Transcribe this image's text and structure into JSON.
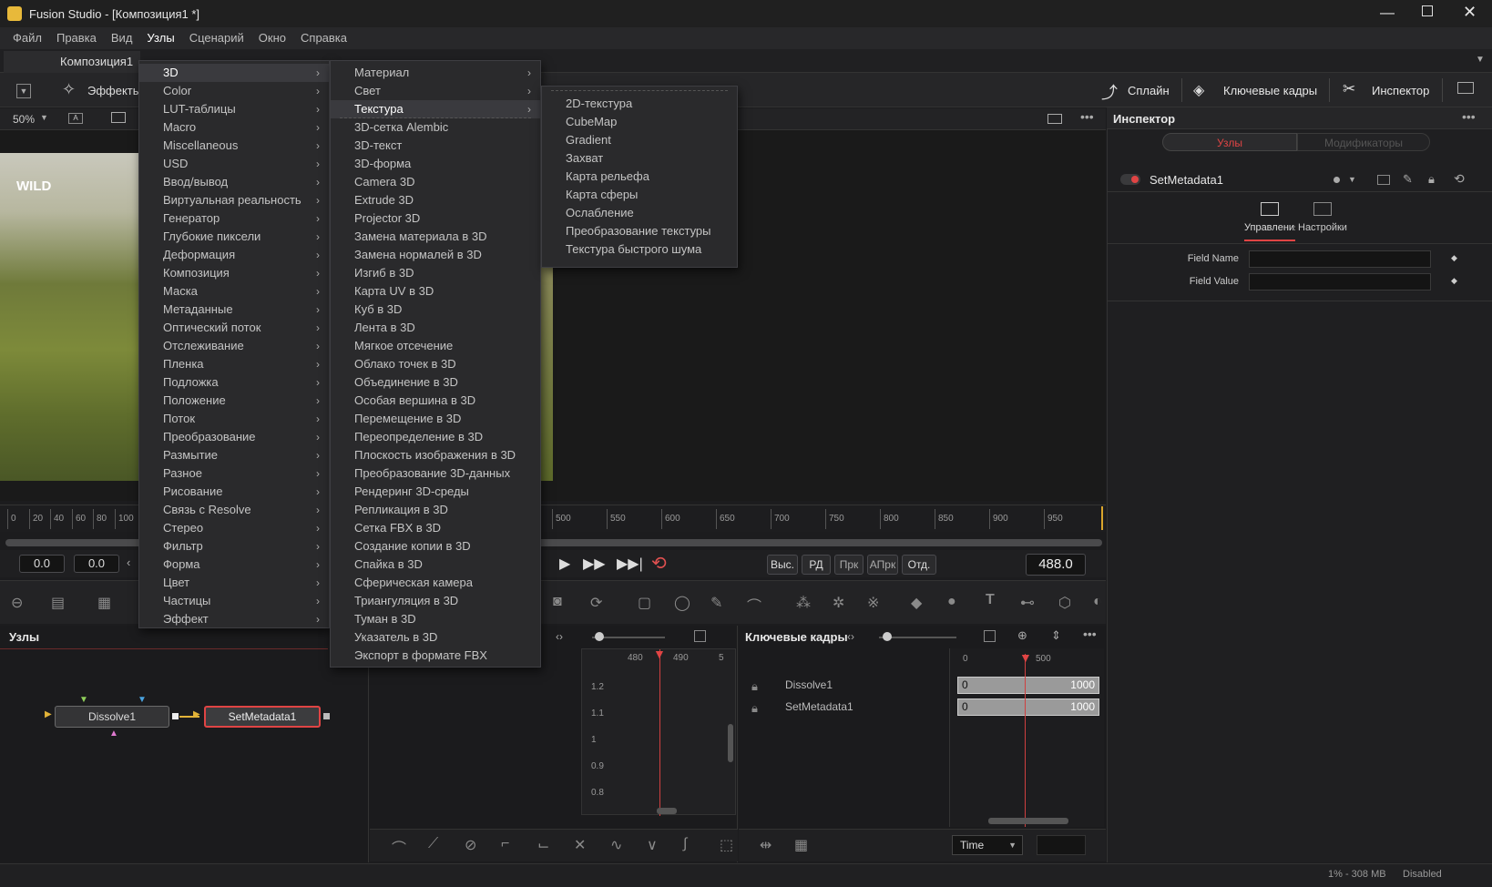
{
  "window": {
    "title": "Fusion Studio - [Композиция1 *]"
  },
  "menubar": [
    "Файл",
    "Правка",
    "Вид",
    "Узлы",
    "Сценарий",
    "Окно",
    "Справка"
  ],
  "doc_tab": "Композиция1 *",
  "toolbar": {
    "effects": "Эффекты",
    "spline": "Сплайн",
    "keyframes": "Ключевые кадры",
    "inspector": "Инспектор"
  },
  "viewer": {
    "zoom": "50%",
    "watermark": "WILD"
  },
  "menu_level1": [
    "3D",
    "Color",
    "LUT-таблицы",
    "Macro",
    "Miscellaneous",
    "USD",
    "Ввод/вывод",
    "Виртуальная реальность",
    "Генератор",
    "Глубокие пиксели",
    "Деформация",
    "Композиция",
    "Маска",
    "Метаданные",
    "Оптический поток",
    "Отслеживание",
    "Пленка",
    "Подложка",
    "Положение",
    "Поток",
    "Преобразование",
    "Размытие",
    "Разное",
    "Рисование",
    "Связь с Resolve",
    "Стерео",
    "Фильтр",
    "Форма",
    "Цвет",
    "Частицы",
    "Эффект"
  ],
  "menu_level2": [
    "Материал",
    "Свет",
    "Текстура",
    "3D-сетка Alembic",
    "3D-текст",
    "3D-форма",
    "Camera 3D",
    "Extrude 3D",
    "Projector 3D",
    "Замена материала в 3D",
    "Замена нормалей в 3D",
    "Изгиб в 3D",
    "Карта UV в 3D",
    "Куб в 3D",
    "Лента в 3D",
    "Мягкое отсечение",
    "Облако точек в 3D",
    "Объединение в 3D",
    "Особая вершина в 3D",
    "Перемещение в 3D",
    "Переопределение в 3D",
    "Плоскость изображения в 3D",
    "Преобразование 3D-данных",
    "Рендеринг 3D-среды",
    "Репликация в 3D",
    "Сетка FBX в 3D",
    "Создание копии в 3D",
    "Спайка в 3D",
    "Сферическая камера",
    "Триангуляция в 3D",
    "Туман в 3D",
    "Указатель в 3D",
    "Экспорт в формате FBX"
  ],
  "menu_level3": [
    "2D-текстура",
    "CubeMap",
    "Gradient",
    "Захват",
    "Карта рельефа",
    "Карта сферы",
    "Ослабление",
    "Преобразование текстуры",
    "Текстура быстрого шума"
  ],
  "timeline": {
    "ticks_left": [
      "0",
      "20",
      "40",
      "60",
      "80",
      "100"
    ],
    "ticks_right": [
      "500",
      "550",
      "600",
      "650",
      "700",
      "750",
      "800",
      "850",
      "900",
      "950"
    ],
    "start": "0.0",
    "end": "0.0",
    "current": "488.0",
    "buttons": [
      "Выс. к",
      "РД",
      "Прк",
      "АПрк",
      "Отд."
    ]
  },
  "nodes": {
    "title": "Узлы",
    "items": [
      "Dissolve1",
      "SetMetadata1"
    ]
  },
  "spline": {
    "ticks": [
      "480",
      "490",
      "5"
    ],
    "yticks": [
      "1.2",
      "1.1",
      "1",
      "0.9",
      "0.8"
    ]
  },
  "keyframes": {
    "title": "Ключевые кадры",
    "ticks": [
      "0",
      "500"
    ],
    "rows": [
      {
        "name": "Dissolve1",
        "start": "0",
        "end": "1000"
      },
      {
        "name": "SetMetadata1",
        "start": "0",
        "end": "1000"
      }
    ],
    "time_select": "Time"
  },
  "inspector": {
    "title": "Инспектор",
    "tab_nodes": "Узлы",
    "tab_modifiers": "Модификаторы",
    "node_name": "SetMetadata1",
    "sub_controls": "Управления",
    "sub_settings": "Настройки",
    "field_name": "Field Name",
    "field_value": "Field Value"
  },
  "status": {
    "mem": "1% - 308 MB",
    "state": "Disabled"
  },
  "colors": {
    "accent": "#e23b3b",
    "panel": "#1c1c1e",
    "menu": "#2a2a2c"
  }
}
